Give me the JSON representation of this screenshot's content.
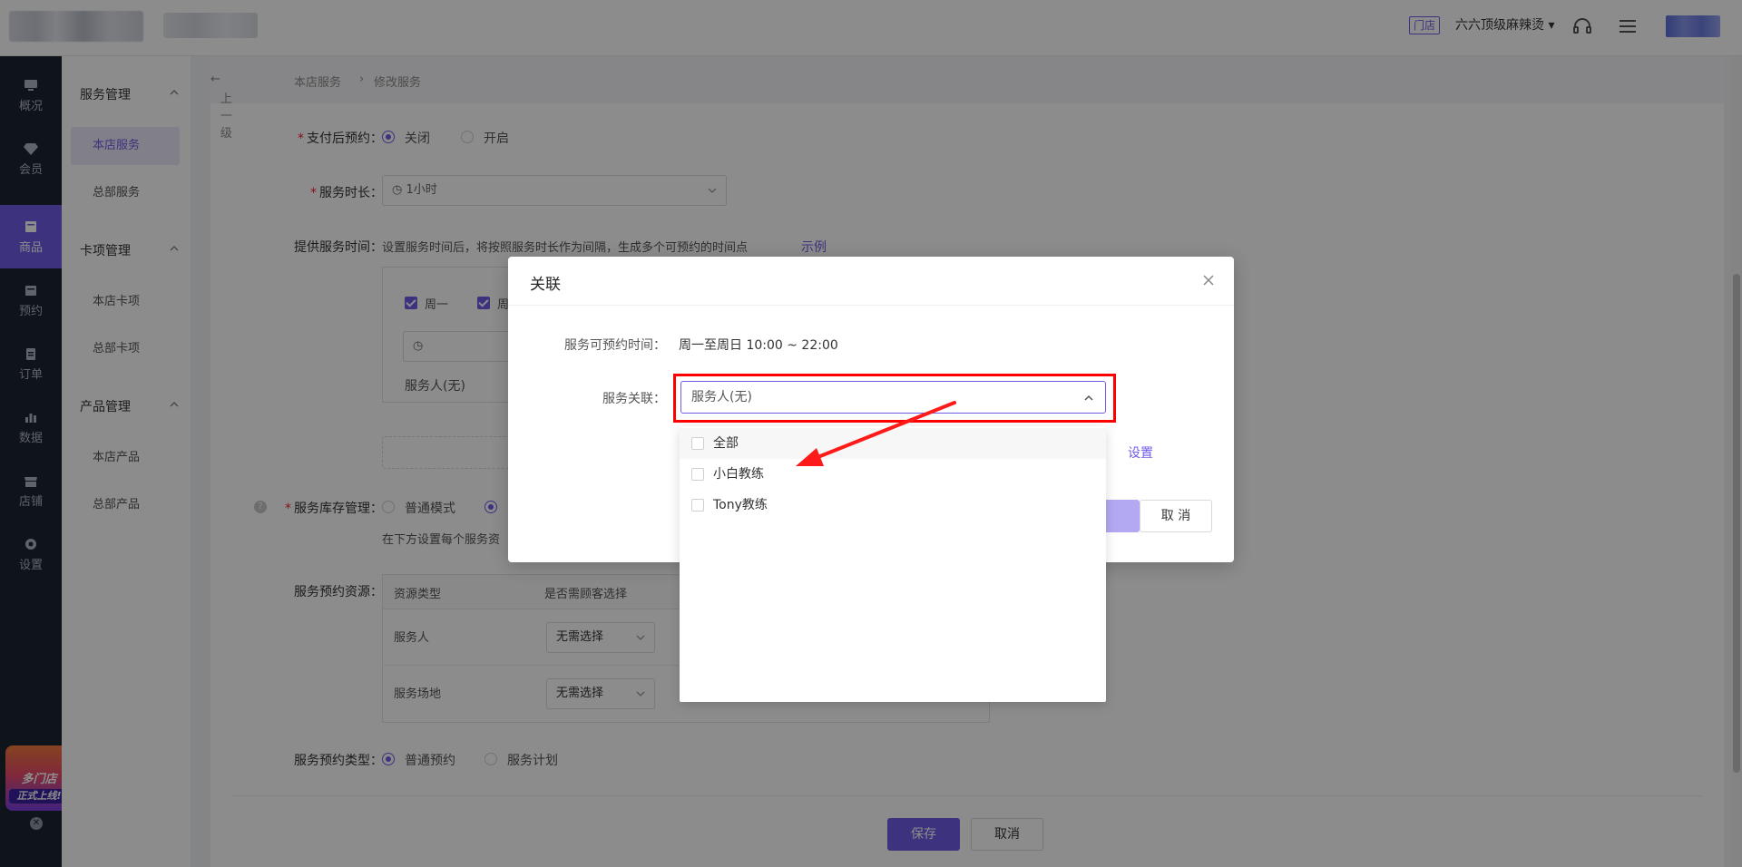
{
  "header": {
    "store_tag": "门店",
    "store_name": "六六顶级麻辣烫"
  },
  "main_nav": [
    {
      "label": "概况",
      "icon": "monitor-icon"
    },
    {
      "label": "会员",
      "icon": "diamond-icon"
    },
    {
      "label": "商品",
      "icon": "box-icon",
      "active": true
    },
    {
      "label": "预约",
      "icon": "calendar-icon"
    },
    {
      "label": "订单",
      "icon": "clipboard-icon"
    },
    {
      "label": "数据",
      "icon": "bar-chart-icon"
    },
    {
      "label": "店铺",
      "icon": "shop-icon"
    },
    {
      "label": "设置",
      "icon": "gear-icon"
    }
  ],
  "promo": {
    "title": "多门店",
    "subtitle": "正式上线!"
  },
  "sub_nav": {
    "groups": [
      {
        "title": "服务管理",
        "items": [
          "本店服务",
          "总部服务"
        ]
      },
      {
        "title": "卡项管理",
        "items": [
          "本店卡项",
          "总部卡项"
        ]
      },
      {
        "title": "产品管理",
        "items": [
          "本店产品",
          "总部产品"
        ]
      }
    ],
    "active_item": "本店服务"
  },
  "breadcrumb": {
    "back": "上一级",
    "parent": "本店服务",
    "current": "修改服务"
  },
  "form": {
    "pay_after_booking": {
      "label": "支付后预约：",
      "options": [
        "关闭",
        "开启"
      ],
      "selected": "关闭"
    },
    "duration": {
      "label": "服务时长：",
      "value": "1小时"
    },
    "service_time": {
      "label": "提供服务时间：",
      "hint": "设置服务时间后，将按照服务时长作为间隔，生成多个可预约的时间点",
      "example_link": "示例"
    },
    "days": [
      "周一",
      "周"
    ],
    "service_person_line": "服务人(无)",
    "stock": {
      "label": "服务库存管理：",
      "options": [
        "普通模式",
        ""
      ],
      "hint": "在下方设置每个服务资"
    },
    "resources": {
      "label": "服务预约资源：",
      "columns": [
        "资源类型",
        "是否需顾客选择"
      ],
      "rows": [
        {
          "type": "服务人",
          "choice": "无需选择"
        },
        {
          "type": "服务场地",
          "choice": "无需选择"
        }
      ]
    },
    "booking_type": {
      "label": "服务预约类型：",
      "options": [
        "普通预约",
        "服务计划"
      ],
      "selected": "普通预约"
    },
    "save": "保存",
    "cancel": "取消"
  },
  "modal": {
    "title": "关联",
    "bookable_label": "服务可预约时间：",
    "bookable_value": "周一至周日 10:00 ~ 22:00",
    "link_label": "服务关联：",
    "select_value": "服务人(无)",
    "settings_link": "设置",
    "cancel": "取 消"
  },
  "dropdown": {
    "options": [
      "全部",
      "小白教练",
      "Tony教练"
    ]
  },
  "colors": {
    "accent": "#6e5ce6",
    "annotation": "#ff0000",
    "sidebar": "#1c2331"
  }
}
